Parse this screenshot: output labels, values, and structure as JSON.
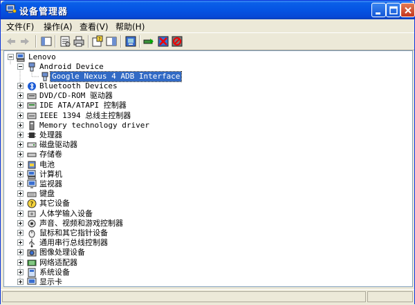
{
  "window": {
    "title": "设备管理器"
  },
  "menubar": [
    {
      "label": "文件(F)"
    },
    {
      "label": "操作(A)"
    },
    {
      "label": "查看(V)"
    },
    {
      "label": "帮助(H)"
    }
  ],
  "tree": {
    "root": "Lenovo",
    "android": "Android Device",
    "android_child": "Google Nexus 4 ADB Interface",
    "categories": [
      "Bluetooth Devices",
      "DVD/CD-ROM 驱动器",
      "IDE ATA/ATAPI 控制器",
      "IEEE 1394 总线主控制器",
      "Memory technology driver",
      "处理器",
      "磁盘驱动器",
      "存储卷",
      "电池",
      "计算机",
      "监视器",
      "键盘",
      "其它设备",
      "人体学输入设备",
      "声音、视频和游戏控制器",
      "鼠标和其它指针设备",
      "通用串行总线控制器",
      "图像处理设备",
      "网络适配器",
      "系统设备",
      "显示卡"
    ]
  },
  "colors": {
    "titlebar": "#0554e3",
    "selection": "#316ac5"
  }
}
